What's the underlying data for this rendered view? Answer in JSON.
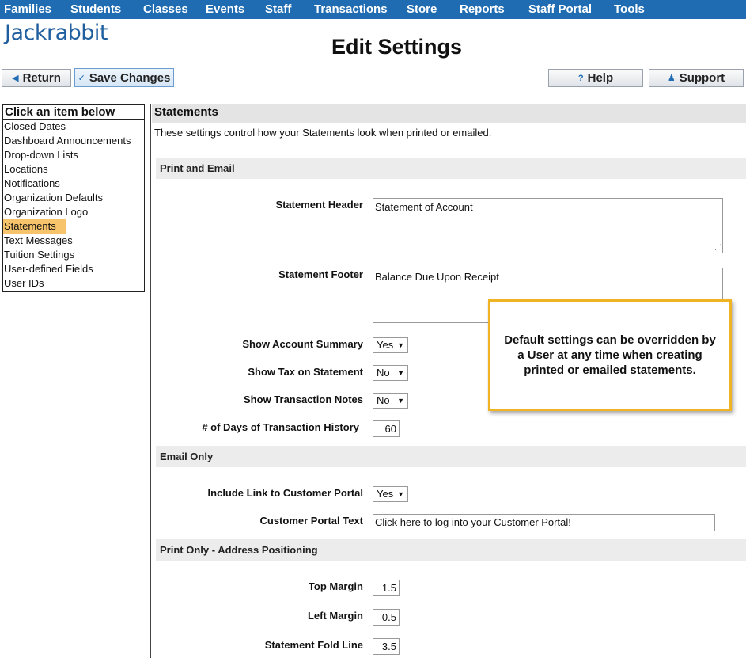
{
  "nav": [
    "Families",
    "Students",
    "Classes",
    "Events",
    "Staff",
    "Transactions",
    "Store",
    "Reports",
    "Staff Portal",
    "Tools"
  ],
  "logo": "Jackrabbit",
  "title": "Edit Settings",
  "buttons": {
    "return": "Return",
    "save": "Save Changes",
    "help": "Help",
    "support": "Support"
  },
  "sidebar": {
    "heading": "Click an item below",
    "items": [
      "Closed Dates",
      "Dashboard Announcements",
      "Drop-down Lists",
      "Locations",
      "Notifications",
      "Organization Defaults",
      "Organization Logo",
      "Statements",
      "Text Messages",
      "Tuition Settings",
      "User-defined Fields",
      "User IDs"
    ],
    "active": "Statements"
  },
  "statements": {
    "title": "Statements",
    "description": "These settings control how your Statements look when printed or emailed.",
    "print_email": {
      "heading": "Print and Email",
      "header_label": "Statement Header",
      "header_value": "Statement of Account",
      "footer_label": "Statement Footer",
      "footer_value": "Balance Due Upon Receipt",
      "summary_label": "Show Account Summary",
      "summary_value": "Yes",
      "tax_label": "Show Tax on Statement",
      "tax_value": "No",
      "notes_label": "Show Transaction Notes",
      "notes_value": "No",
      "days_label": "# of Days of Transaction History",
      "days_value": "60"
    },
    "email_only": {
      "heading": "Email Only",
      "link_label": "Include Link to Customer Portal",
      "link_value": "Yes",
      "portal_text_label": "Customer Portal Text",
      "portal_text_value": "Click here to log into your Customer Portal!"
    },
    "print_only": {
      "heading": "Print Only - Address Positioning",
      "top_label": "Top Margin",
      "top_value": "1.5",
      "left_label": "Left Margin",
      "left_value": "0.5",
      "fold_label": "Statement Fold Line",
      "fold_value": "3.5"
    }
  },
  "callout": "Default settings can be overridden by a User at any time when creating printed or emailed statements.",
  "colors": {
    "nav_bg": "#1f6cb3",
    "active_item": "#f7c46b",
    "callout_border": "#f0b323"
  },
  "icons": {
    "return": "left-triangle-icon",
    "save": "checkmark-icon",
    "help": "question-icon",
    "support": "person-icon"
  }
}
